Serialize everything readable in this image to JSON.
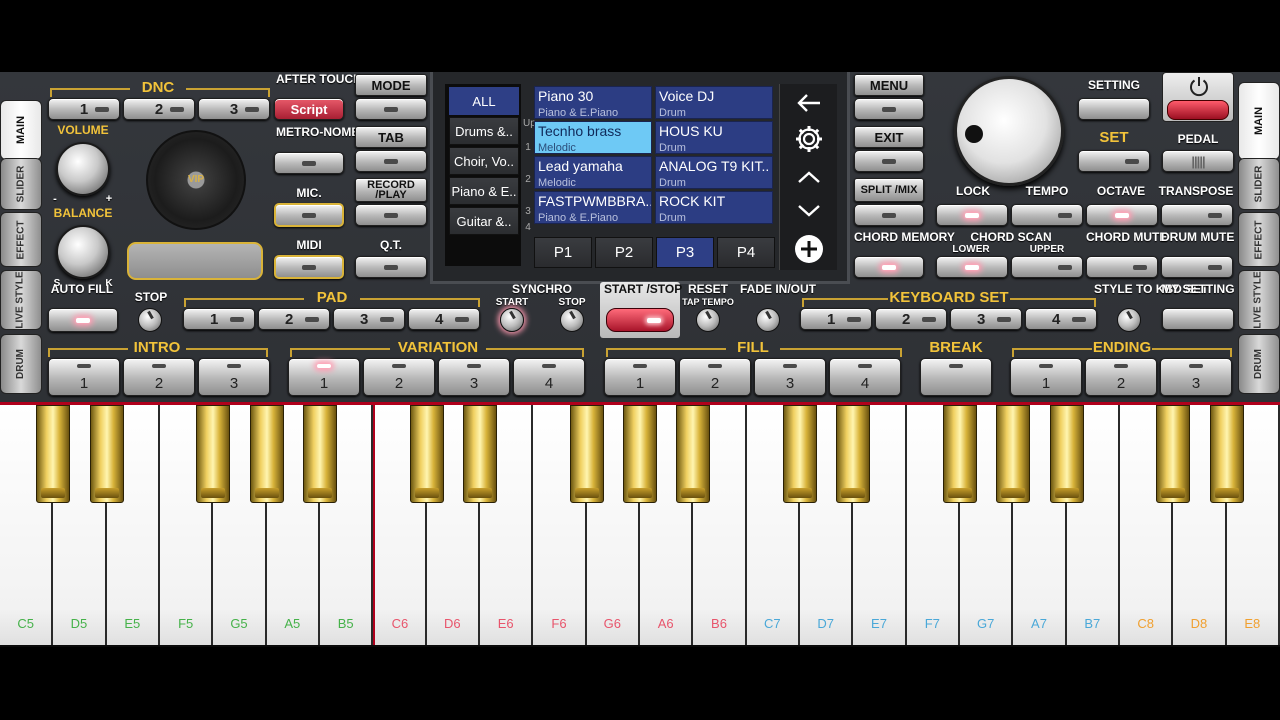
{
  "left_tabs": [
    "MAIN",
    "SLIDER",
    "EFFECT",
    "LIVE STYLE",
    "DRUM"
  ],
  "right_tabs": [
    "MAIN",
    "SLIDER",
    "EFFECT",
    "LIVE STYLE",
    "DRUM"
  ],
  "dnc": {
    "label": "DNC",
    "buttons": [
      "1",
      "2",
      "3"
    ]
  },
  "after_touch": {
    "label": "AFTER TOUCH",
    "button": "Script"
  },
  "volume": "VOLUME",
  "balance": "BALANCE",
  "balance_s": "S",
  "balance_k": "K",
  "vol_minus": "-",
  "vol_plus": "+",
  "metronome": "METRO-NOME",
  "mic": "MIC.",
  "midi": "MIDI",
  "vip_logo": "VIP",
  "mode": {
    "mode": "MODE",
    "tab": "TAB",
    "record": "RECORD /PLAY",
    "qt": "Q.T."
  },
  "browser": {
    "categories": [
      "ALL",
      "Drums &..",
      "Choir, Vo..",
      "Piano & E..",
      "Guitar &.."
    ],
    "index_up": "Up",
    "index": [
      "1",
      "2",
      "3",
      "4"
    ],
    "sounds": [
      {
        "name": "Piano 30",
        "cat": "Piano & E.Piano"
      },
      {
        "name": "Voice DJ",
        "cat": "Drum"
      },
      {
        "name": "Tecnho brass",
        "cat": "Melodic"
      },
      {
        "name": "HOUS KU",
        "cat": "Drum"
      },
      {
        "name": "Lead yamaha",
        "cat": "Melodic"
      },
      {
        "name": "ANALOG T9 KIT..",
        "cat": "Drum"
      },
      {
        "name": "FASTPWMBBRA..",
        "cat": "Piano & E.Piano"
      },
      {
        "name": "ROCK KIT",
        "cat": "Drum"
      }
    ],
    "pages": [
      "P1",
      "P2",
      "P3",
      "P4"
    ],
    "selected_page": "P3"
  },
  "menu": {
    "menu": "MENU",
    "exit": "EXIT",
    "split": "SPLIT /MIX",
    "chord_memory": "CHORD MEMORY"
  },
  "setting": "SETTING",
  "set": "SET",
  "pedal": "PEDAL",
  "lock": "LOCK",
  "tempo": "TEMPO",
  "octave": "OCTAVE",
  "transpose": "TRANSPOSE",
  "chord_scan": "CHORD SCAN",
  "lower": "LOWER",
  "upper": "UPPER",
  "chord_mute": "CHORD MUTE",
  "drum_mute": "DRUM MUTE",
  "auto_fill": "AUTO FILL",
  "stop": "STOP",
  "pad": {
    "label": "PAD",
    "buttons": [
      "1",
      "2",
      "3",
      "4"
    ]
  },
  "synchro": "SYNCHRO",
  "synchro_start": "START",
  "synchro_stop": "STOP",
  "start_stop": "START /STOP",
  "reset": "RESET",
  "tap_tempo": "TAP TEMPO",
  "fade": "FADE IN/OUT",
  "keyboard_set": {
    "label": "KEYBOARD SET",
    "buttons": [
      "1",
      "2",
      "3",
      "4"
    ]
  },
  "style_to_kbd": "STYLE TO KBD SET",
  "my_setting": "MY SETTING",
  "intro": {
    "label": "INTRO",
    "buttons": [
      "1",
      "2",
      "3"
    ]
  },
  "variation": {
    "label": "VARIATION",
    "buttons": [
      "1",
      "2",
      "3",
      "4"
    ]
  },
  "fill": {
    "label": "FILL",
    "buttons": [
      "1",
      "2",
      "3",
      "4"
    ]
  },
  "break": "BREAK",
  "ending": {
    "label": "ENDING",
    "buttons": [
      "1",
      "2",
      "3"
    ]
  },
  "keys": [
    "C5",
    "D5",
    "E5",
    "F5",
    "G5",
    "A5",
    "B5",
    "C6",
    "D6",
    "E6",
    "F6",
    "G6",
    "A6",
    "B6",
    "C7",
    "D7",
    "E7",
    "F7",
    "G7",
    "A7",
    "B7",
    "C8",
    "D8",
    "E8"
  ],
  "key_colors": {
    "o5": "#46b24a",
    "o6": "#e8556c",
    "o7": "#4aa8d8",
    "o8": "#f0a030"
  },
  "colors": {
    "gold": "#f2c33a",
    "accent_red": "#b0001c",
    "list_blue": "#2c3d83",
    "list_selected": "#6ec9f5"
  }
}
